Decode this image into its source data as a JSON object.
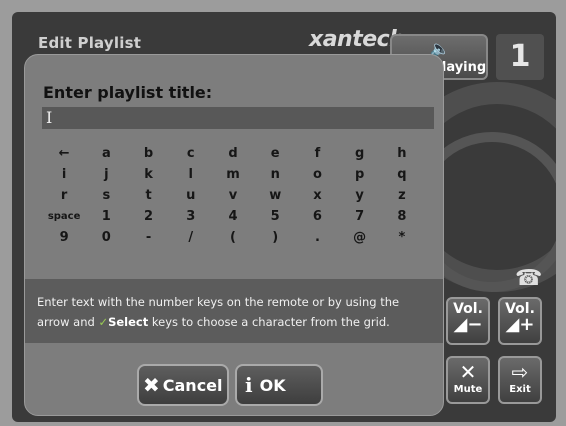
{
  "header": {
    "title": "Edit Playlist",
    "brand": "xantech"
  },
  "now_playing": {
    "label": "Now Playing",
    "icon": "speaker-icon"
  },
  "zone_number": "1",
  "side_controls": {
    "phone_icon": "☎",
    "vol_down_label": "Vol.",
    "vol_up_label": "Vol.",
    "mute_label": "Mute",
    "exit_label": "Exit"
  },
  "dialog": {
    "prompt": "Enter playlist title:",
    "input_value": "",
    "keys": [
      [
        "←",
        "a",
        "b",
        "c",
        "d",
        "e",
        "f",
        "g",
        "h"
      ],
      [
        "i",
        "j",
        "k",
        "l",
        "m",
        "n",
        "o",
        "p",
        "q"
      ],
      [
        "r",
        "s",
        "t",
        "u",
        "v",
        "w",
        "x",
        "y",
        "z"
      ],
      [
        "space",
        "1",
        "2",
        "3",
        "4",
        "5",
        "6",
        "7",
        "8"
      ],
      [
        "9",
        "0",
        "-",
        "/",
        "(",
        ")",
        ".",
        "@",
        "*"
      ]
    ],
    "help_line1": "Enter text with the number keys on the remote or by using the",
    "help_line2_pre": "arrow and",
    "help_select": "Select",
    "help_line2_post": "keys to choose a character from the grid.",
    "cancel_label": "Cancel",
    "ok_label": "OK"
  },
  "colors": {
    "select_check": "#9acb54"
  }
}
